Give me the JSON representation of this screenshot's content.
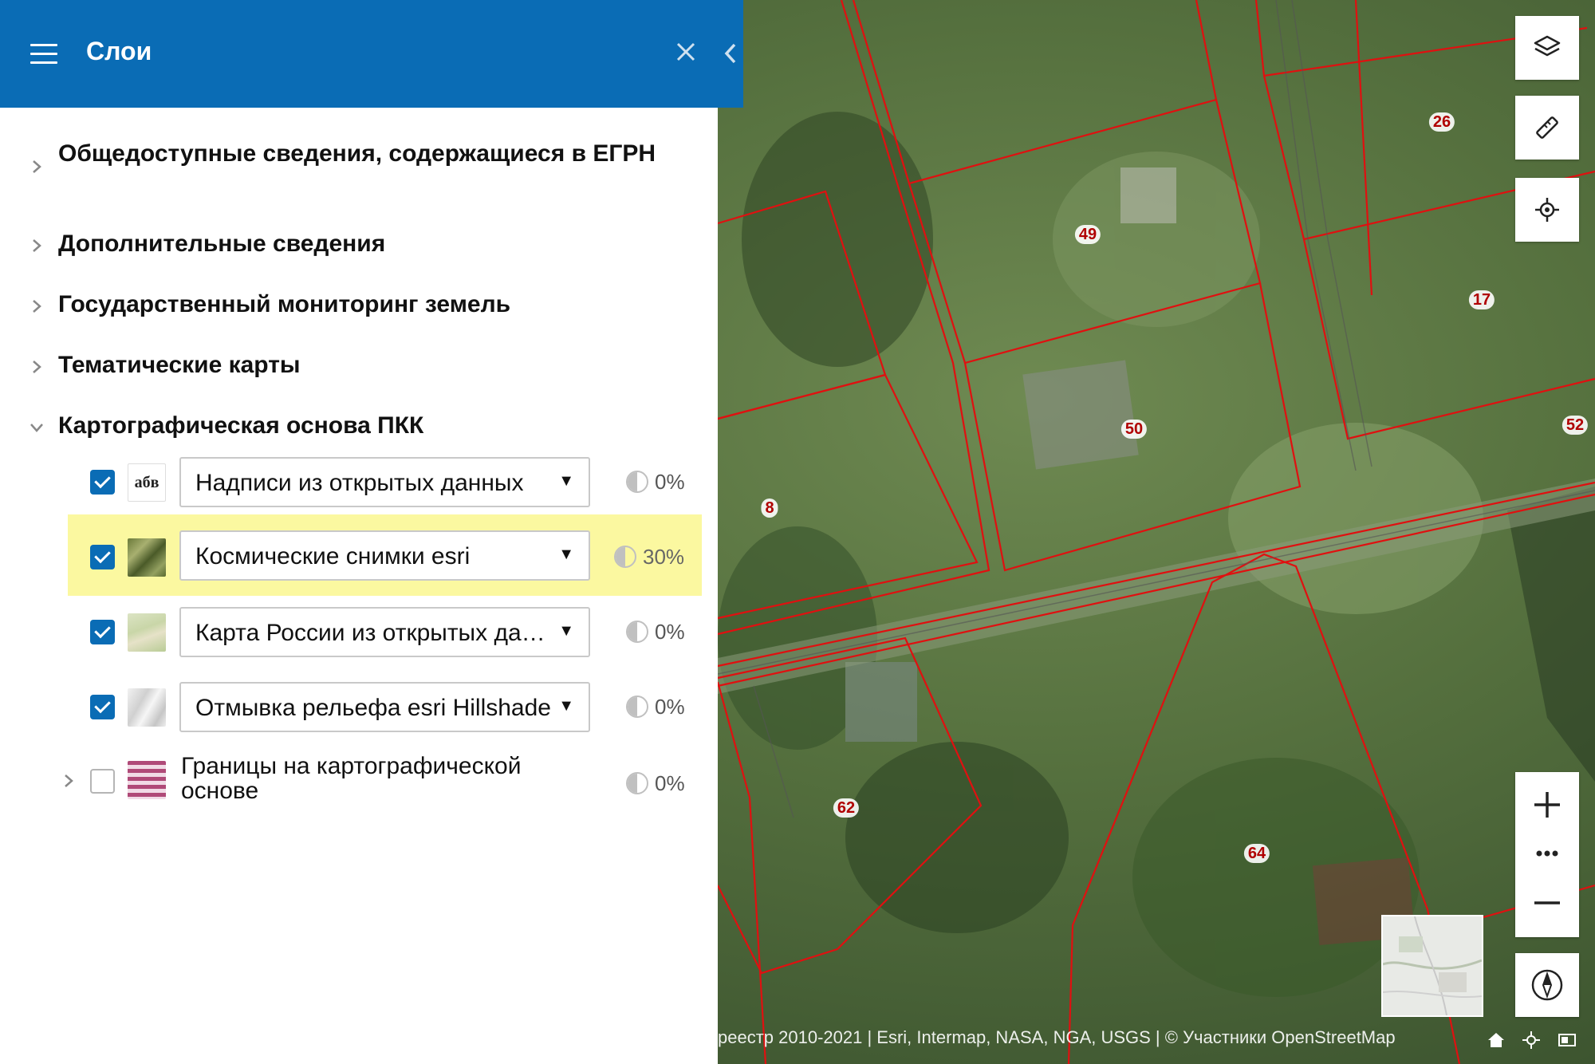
{
  "panel": {
    "title": "Слои",
    "groups": [
      {
        "label": "Общедоступные сведения, содержащиеся в ЕГРН",
        "expanded": false
      },
      {
        "label": "Дополнительные сведения",
        "expanded": false
      },
      {
        "label": "Государственный мониторинг земель",
        "expanded": false
      },
      {
        "label": "Тематические карты",
        "expanded": false
      },
      {
        "label": "Картографическая основа ПКК",
        "expanded": true
      }
    ],
    "layers": [
      {
        "name": "Надписи из открытых данных",
        "thumb_text": "абв",
        "checked": true,
        "opacity": "0%",
        "highlighted": false
      },
      {
        "name": "Космические снимки esri",
        "checked": true,
        "opacity": "30%",
        "highlighted": true
      },
      {
        "name": "Карта России из открытых данных",
        "checked": true,
        "opacity": "0%",
        "highlighted": false
      },
      {
        "name": "Отмывка рельефа esri Hillshade",
        "checked": true,
        "opacity": "0%",
        "highlighted": false
      }
    ],
    "sublayer": {
      "name_line1": "Границы на картографической",
      "name_line2": "основе",
      "checked": false,
      "opacity": "0%"
    }
  },
  "map": {
    "parcel_labels": [
      "49",
      "26",
      "17",
      "50",
      "52",
      "8",
      "62",
      "64"
    ],
    "attribution": "реестр 2010-2021 | Esri, Intermap, NASA, NGA, USGS | © Участники OpenStreetMap",
    "colors": {
      "parcel_border": "#e01010",
      "header": "#0a6cb5",
      "highlight": "#fbf8a0"
    }
  },
  "icons": {
    "menu": "hamburger-icon",
    "close": "close-icon",
    "collapse": "chevron-left-icon",
    "layers": "layers-icon",
    "ruler": "ruler-icon",
    "locate": "locate-icon",
    "zoom_in": "plus-icon",
    "zoom_out": "minus-icon",
    "more": "more-dots-icon",
    "compass": "compass-icon",
    "home": "home-icon",
    "crosshair": "crosshair-icon",
    "screen": "screen-icon"
  }
}
